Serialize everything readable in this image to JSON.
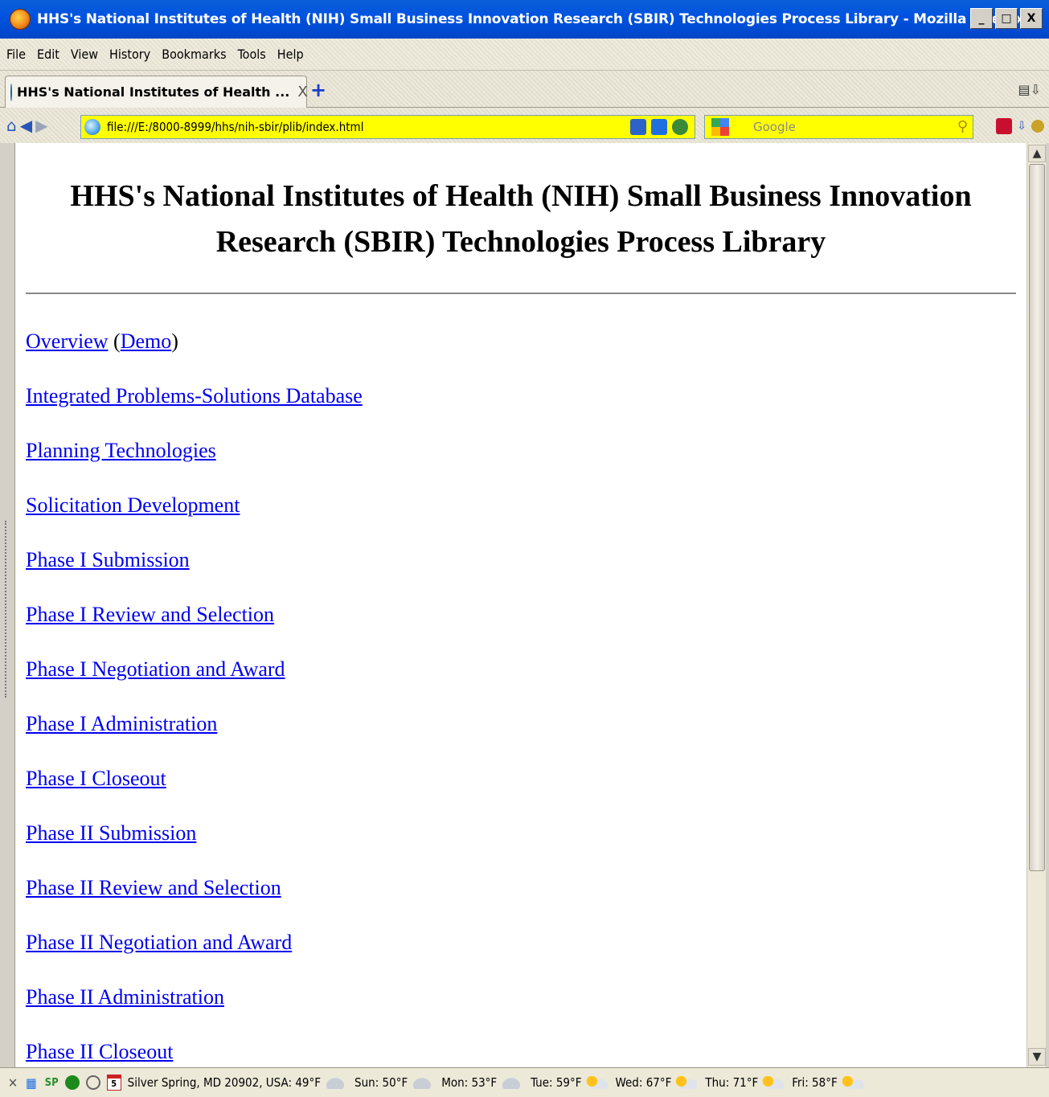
{
  "window": {
    "title": "HHS's National Institutes of Health (NIH) Small Business Innovation Research (SBIR) Technologies Process Library - Mozilla Firefox",
    "controls": [
      "_",
      "□",
      "X"
    ]
  },
  "menu": [
    "File",
    "Edit",
    "View",
    "History",
    "Bookmarks",
    "Tools",
    "Help"
  ],
  "tab": {
    "label": "HHS's National Institutes of Health ...",
    "close": "X",
    "new_tab": "+"
  },
  "address": {
    "url": "file:///E:/8000-8999/hhs/nih-sbir/plib/index.html"
  },
  "search": {
    "placeholder": "Google"
  },
  "page": {
    "title": "HHS's National Institutes of Health (NIH) Small Business Innovation Research (SBIR) Technologies Process Library",
    "overview_link": "Overview",
    "demo_link": "Demo",
    "links": [
      "Integrated Problems-Solutions Database",
      "Planning Technologies",
      "Solicitation Development",
      "Phase I Submission",
      "Phase I Review and Selection",
      "Phase I Negotiation and Award",
      "Phase I Administration",
      "Phase I Closeout",
      "Phase II Submission",
      "Phase II Review and Selection",
      "Phase II Negotiation and Award",
      "Phase II Administration",
      "Phase II Closeout"
    ]
  },
  "status": {
    "sp": "SP",
    "calendar_day": "5",
    "location": "Silver Spring, MD 20902, USA: 49°F",
    "forecast": [
      {
        "day": "Sun: 50°F",
        "icon": "cloud"
      },
      {
        "day": "Mon: 53°F",
        "icon": "cloud"
      },
      {
        "day": "Tue: 59°F",
        "icon": "sun"
      },
      {
        "day": "Wed: 67°F",
        "icon": "sun"
      },
      {
        "day": "Thu: 71°F",
        "icon": "sun"
      },
      {
        "day": "Fri: 58°F",
        "icon": "sun"
      }
    ]
  }
}
